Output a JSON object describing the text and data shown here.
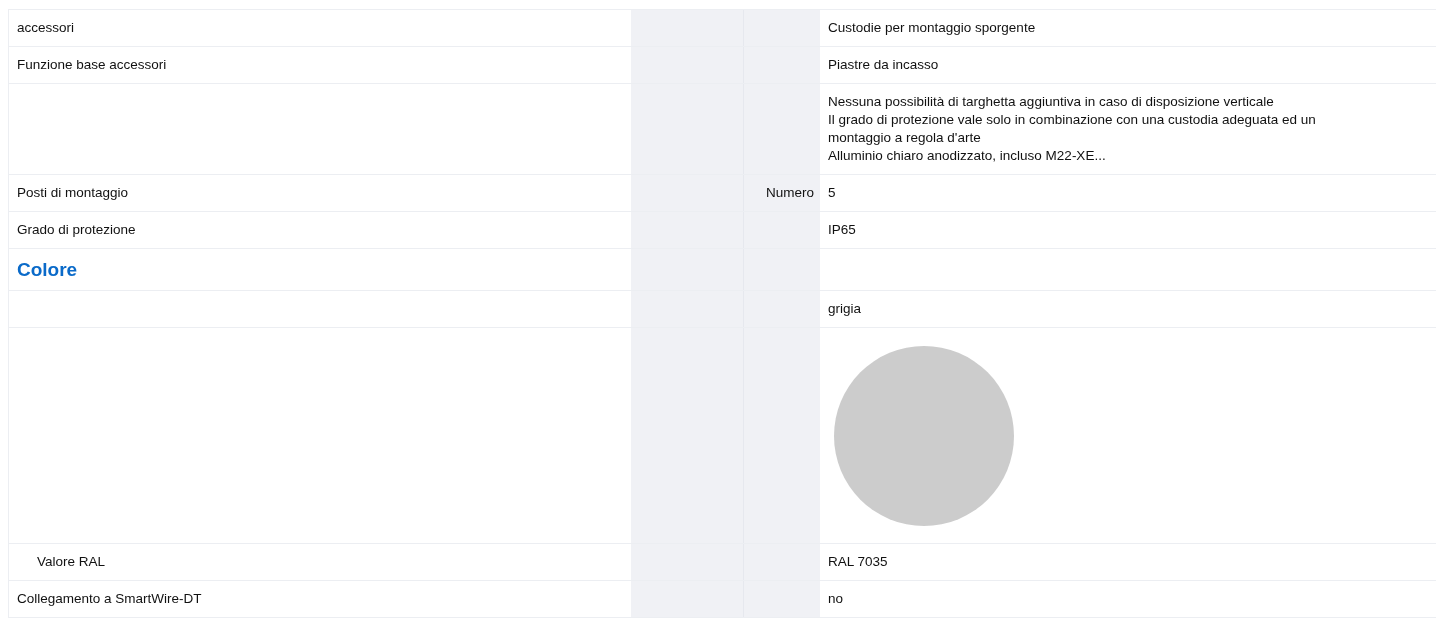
{
  "rows": [
    {
      "kind": "row",
      "label": "accessori",
      "unit": "",
      "value": [
        "Custodie per montaggio sporgente"
      ]
    },
    {
      "kind": "row",
      "label": "Funzione base accessori",
      "unit": "",
      "value": [
        "Piastre da incasso"
      ]
    },
    {
      "kind": "row",
      "label": "",
      "unit": "",
      "value": [
        "Nessuna possibilità di targhetta aggiuntiva in caso di disposizione verticale",
        "Il grado di protezione vale solo in combinazione con una custodia adeguata ed un montaggio a regola d'arte",
        "Alluminio chiaro anodizzato, incluso M22-XE..."
      ]
    },
    {
      "kind": "row",
      "label": "Posti di montaggio",
      "unit": "Numero",
      "value": [
        "5"
      ]
    },
    {
      "kind": "row",
      "label": "Grado di protezione",
      "unit": "",
      "value": [
        "IP65"
      ]
    },
    {
      "kind": "heading",
      "label": "Colore"
    },
    {
      "kind": "row",
      "label": "",
      "unit": "",
      "value": [
        "grigia"
      ]
    },
    {
      "kind": "swatch"
    },
    {
      "kind": "subrow",
      "label": "Valore RAL",
      "unit": "",
      "value": [
        "RAL 7035"
      ]
    },
    {
      "kind": "row",
      "label": "Collegamento a SmartWire-DT",
      "unit": "",
      "value": [
        "no"
      ]
    }
  ]
}
